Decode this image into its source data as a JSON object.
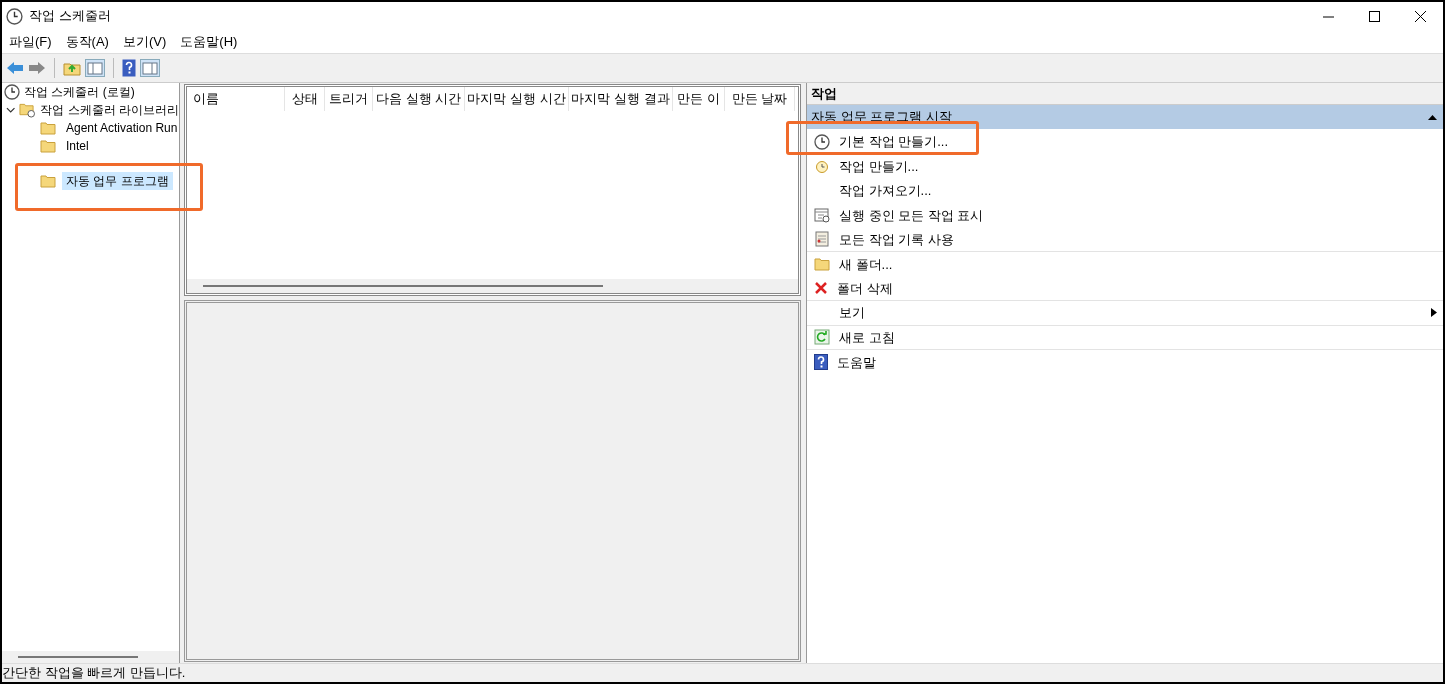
{
  "window": {
    "title": "작업 스케줄러"
  },
  "menu": [
    "파일(F)",
    "동작(A)",
    "보기(V)",
    "도움말(H)"
  ],
  "tree": {
    "label": "작업 스케줄러 (로컬)",
    "children": [
      {
        "label": "작업 스케줄러 라이브러리",
        "expanded": true,
        "children": [
          {
            "label": "Agent Activation Run",
            "selected": false
          },
          {
            "label": "Intel",
            "selected": false
          },
          {
            "label": "자동 업무 프로그램",
            "selected": true
          }
        ]
      }
    ]
  },
  "table": {
    "columns": [
      "이름",
      "상태",
      "트리거",
      "다음 실행 시간",
      "마지막 실행 시간",
      "마지막 실행 결과",
      "만든 이",
      "만든 날짜"
    ]
  },
  "actions": {
    "title": "작업",
    "section": {
      "label": "자동 업무 프로그램 시작",
      "expanded": true
    },
    "items": [
      {
        "label": "기본 작업 만들기...",
        "kind": "action",
        "divider_below": false
      },
      {
        "label": "작업 만들기...",
        "kind": "action",
        "divider_below": false
      },
      {
        "label": "작업 가져오기...",
        "kind": "action",
        "divider_below": false
      },
      {
        "label": "실행 중인 모든 작업 표시",
        "kind": "action",
        "divider_below": false
      },
      {
        "label": "모든 작업 기록 사용",
        "kind": "action",
        "divider_below": true
      },
      {
        "label": "새 폴더...",
        "kind": "action",
        "divider_below": false
      },
      {
        "label": "폴더 삭제",
        "kind": "action",
        "divider_below": true
      },
      {
        "label": "보기",
        "kind": "submenu",
        "divider_below": true
      },
      {
        "label": "새로 고침",
        "kind": "action",
        "divider_below": true
      },
      {
        "label": "도움말",
        "kind": "action",
        "divider_below": false
      }
    ]
  },
  "status_bar": "간단한 작업을 빠르게 만듭니다."
}
